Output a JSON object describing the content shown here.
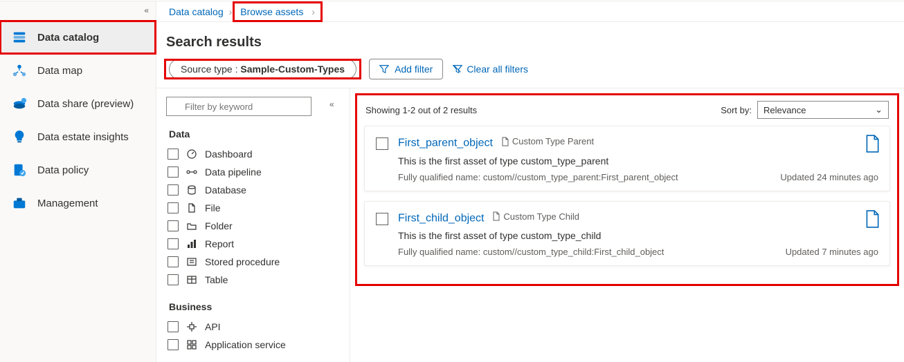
{
  "sidebar": {
    "items": [
      {
        "label": "Data catalog"
      },
      {
        "label": "Data map"
      },
      {
        "label": "Data share (preview)"
      },
      {
        "label": "Data estate insights"
      },
      {
        "label": "Data policy"
      },
      {
        "label": "Management"
      }
    ]
  },
  "breadcrumb": {
    "root": "Data catalog",
    "current": "Browse assets"
  },
  "heading": "Search results",
  "filters": {
    "chip_label": "Source type : ",
    "chip_value": "Sample-Custom-Types",
    "add": "Add filter",
    "clear": "Clear all filters"
  },
  "filtercol": {
    "placeholder": "Filter by keyword",
    "group1": "Data",
    "opts1": [
      {
        "label": "Dashboard"
      },
      {
        "label": "Data pipeline"
      },
      {
        "label": "Database"
      },
      {
        "label": "File"
      },
      {
        "label": "Folder"
      },
      {
        "label": "Report"
      },
      {
        "label": "Stored procedure"
      },
      {
        "label": "Table"
      }
    ],
    "group2": "Business",
    "opts2": [
      {
        "label": "API"
      },
      {
        "label": "Application service"
      }
    ]
  },
  "results": {
    "count": "Showing 1-2 out of 2 results",
    "sort_label": "Sort by:",
    "sort_value": "Relevance",
    "items": [
      {
        "title": "First_parent_object",
        "type": "Custom Type Parent",
        "desc": "This is the first asset of type custom_type_parent",
        "fqn": "Fully qualified name: custom//custom_type_parent:First_parent_object",
        "updated": "Updated 24 minutes ago"
      },
      {
        "title": "First_child_object",
        "type": "Custom Type Child",
        "desc": "This is the first asset of type custom_type_child",
        "fqn": "Fully qualified name: custom//custom_type_child:First_child_object",
        "updated": "Updated 7 minutes ago"
      }
    ]
  }
}
